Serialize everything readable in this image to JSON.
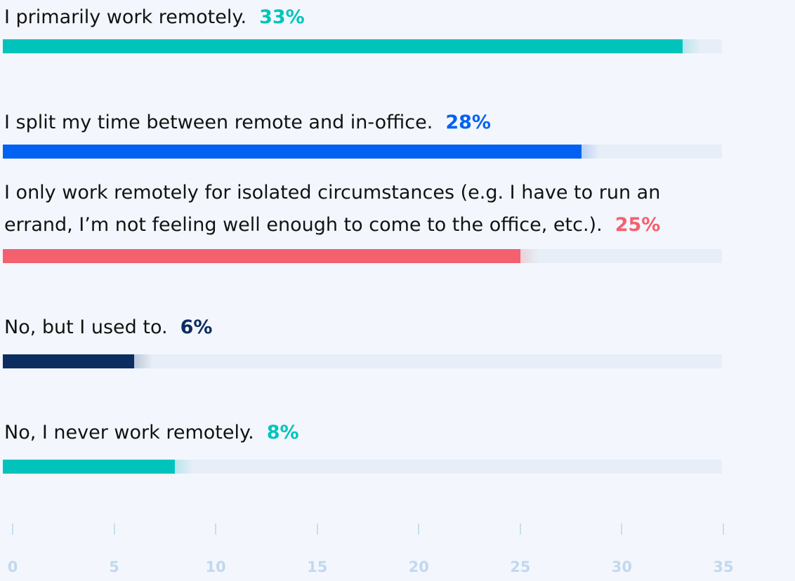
{
  "chart_data": {
    "type": "bar",
    "orientation": "horizontal",
    "categories": [
      "I primarily work remotely.",
      "I split my time between remote and in-office.",
      "I only work remotely for isolated circumstances (e.g. I have to run an errand, I’m not feeling well enough to come to the office, etc.).",
      "No, but I used to.",
      "No, I never work remotely."
    ],
    "values": [
      33,
      28,
      25,
      6,
      8
    ],
    "value_labels": [
      "33%",
      "28%",
      "25%",
      "6%",
      "8%"
    ],
    "bar_colors": [
      "#00c4bc",
      "#0462f2",
      "#f4606e",
      "#0c2d60",
      "#00c4bc"
    ],
    "label_color_first": "#00c4bc",
    "xlim": [
      0,
      35
    ],
    "x_ticks": [
      0,
      5,
      10,
      15,
      20,
      25,
      30,
      35
    ],
    "x_tick_labels": [
      "0",
      "5",
      "10",
      "15",
      "20",
      "25",
      "30",
      "35"
    ],
    "grid": false,
    "legend": "none"
  },
  "rows": [
    {
      "label_lines": [
        "I primarily work remotely."
      ],
      "pct": "33%"
    },
    {
      "label_lines": [
        "I split my time between remote and in-office."
      ],
      "pct": "28%"
    },
    {
      "label_lines": [
        "I only work remotely for isolated circumstances (e.g. I have to run an",
        "errand, I’m not feeling well enough to come to the office, etc.)."
      ],
      "pct": "25%"
    },
    {
      "label_lines": [
        "No, but I used to."
      ],
      "pct": "6%"
    },
    {
      "label_lines": [
        "No, I never work remotely."
      ],
      "pct": "8%"
    }
  ],
  "colors": {
    "background": "#f3f7fd",
    "track": "#e7eef7",
    "text": "#121212",
    "axis": "#c2d8ee"
  }
}
